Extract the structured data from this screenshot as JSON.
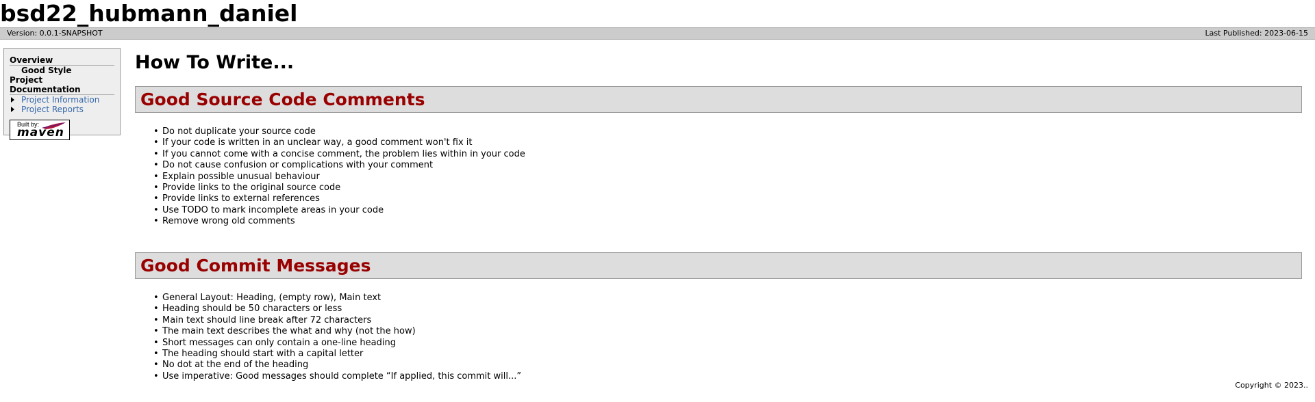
{
  "header": {
    "project_title": "bsd22_hubmann_daniel",
    "version": "Version: 0.0.1-SNAPSHOT",
    "last_published": "Last Published: 2023-06-15"
  },
  "sidebar": {
    "overview": "Overview",
    "good_style": "Good Style",
    "project_documentation": "Project Documentation",
    "links": [
      "Project Information",
      "Project Reports"
    ],
    "badge_built_by": "Built by:",
    "badge_maven": "maven"
  },
  "main": {
    "page_heading": "How To Write...",
    "sections": [
      {
        "title": "Good Source Code Comments",
        "items": [
          "Do not duplicate your source code",
          "If your code is written in an unclear way, a good comment won't fix it",
          "If you cannot come with a concise comment, the problem lies within in your code",
          "Do not cause confusion or complications with your comment",
          "Explain possible unusual behaviour",
          "Provide links to the original source code",
          "Provide links to external references",
          "Use TODO to mark incomplete areas in your code",
          "Remove wrong old comments"
        ]
      },
      {
        "title": "Good Commit Messages",
        "items": [
          "General Layout: Heading, (empty row), Main text",
          "Heading should be 50 characters or less",
          "Main text should line break after 72 characters",
          "The main text describes the what and why (not the how)",
          "Short messages can only contain a one-line heading",
          "The heading should start with a capital letter",
          "No dot at the end of the heading",
          "Use imperative: Good messages should complete “If applied, this commit will...”"
        ]
      }
    ]
  },
  "footer": {
    "copyright": "Copyright © 2023.."
  },
  "colors": {
    "section_title": "#990000",
    "link": "#3366aa",
    "section_bg": "#dddddd",
    "breadcrumb_bg": "#cccccc",
    "sidebar_bg": "#eeeeee"
  }
}
